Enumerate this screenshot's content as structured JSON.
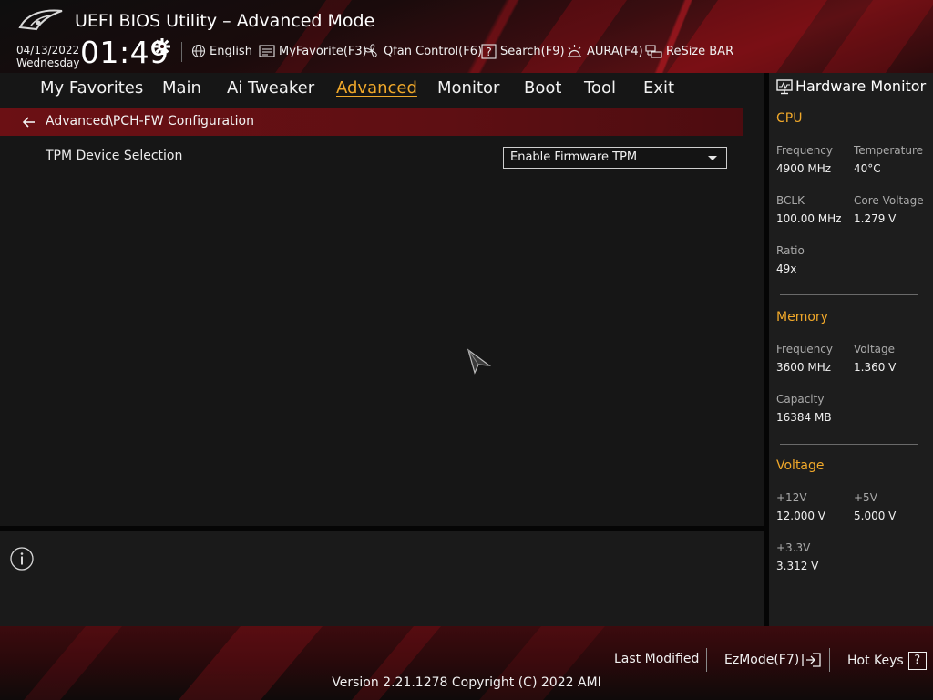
{
  "header": {
    "title": "UEFI BIOS Utility – Advanced Mode",
    "date": "04/13/2022",
    "weekday": "Wednesday",
    "time": "01:49",
    "buttons": [
      {
        "label": "English",
        "icon": "globe-icon"
      },
      {
        "label": "MyFavorite(F3)",
        "icon": "favorite-list-icon"
      },
      {
        "label": "Qfan Control(F6)",
        "icon": "fan-icon"
      },
      {
        "label": "Search(F9)",
        "icon": "search-question-icon"
      },
      {
        "label": "AURA(F4)",
        "icon": "aura-light-icon"
      },
      {
        "label": "ReSize BAR",
        "icon": "resize-bar-icon"
      }
    ]
  },
  "nav": {
    "tabs": [
      "My Favorites",
      "Main",
      "Ai Tweaker",
      "Advanced",
      "Monitor",
      "Boot",
      "Tool",
      "Exit"
    ],
    "active": "Advanced"
  },
  "breadcrumb": "Advanced\\PCH-FW Configuration",
  "settings": [
    {
      "label": "TPM Device Selection",
      "value": "Enable Firmware TPM"
    }
  ],
  "hardware_monitor": {
    "title": "Hardware Monitor",
    "cpu": {
      "section": "CPU",
      "frequency_label": "Frequency",
      "frequency": "4900 MHz",
      "temperature_label": "Temperature",
      "temperature": "40°C",
      "bclk_label": "BCLK",
      "bclk": "100.00 MHz",
      "core_voltage_label": "Core Voltage",
      "core_voltage": "1.279 V",
      "ratio_label": "Ratio",
      "ratio": "49x"
    },
    "memory": {
      "section": "Memory",
      "frequency_label": "Frequency",
      "frequency": "3600 MHz",
      "voltage_label": "Voltage",
      "voltage": "1.360 V",
      "capacity_label": "Capacity",
      "capacity": "16384 MB"
    },
    "voltage": {
      "section": "Voltage",
      "v12_label": "+12V",
      "v12": "12.000 V",
      "v5_label": "+5V",
      "v5": "5.000 V",
      "v33_label": "+3.3V",
      "v33": "3.312 V"
    }
  },
  "footer": {
    "last_modified": "Last Modified",
    "ezmode": "EzMode(F7)",
    "hotkeys": "Hot Keys",
    "hotkeys_badge": "?",
    "version": "Version 2.21.1278 Copyright (C) 2022 AMI"
  },
  "colors": {
    "accent": "#f0a82a",
    "brand_red": "#6b1014",
    "background": "#161616",
    "panel": "#1d1d1d"
  }
}
